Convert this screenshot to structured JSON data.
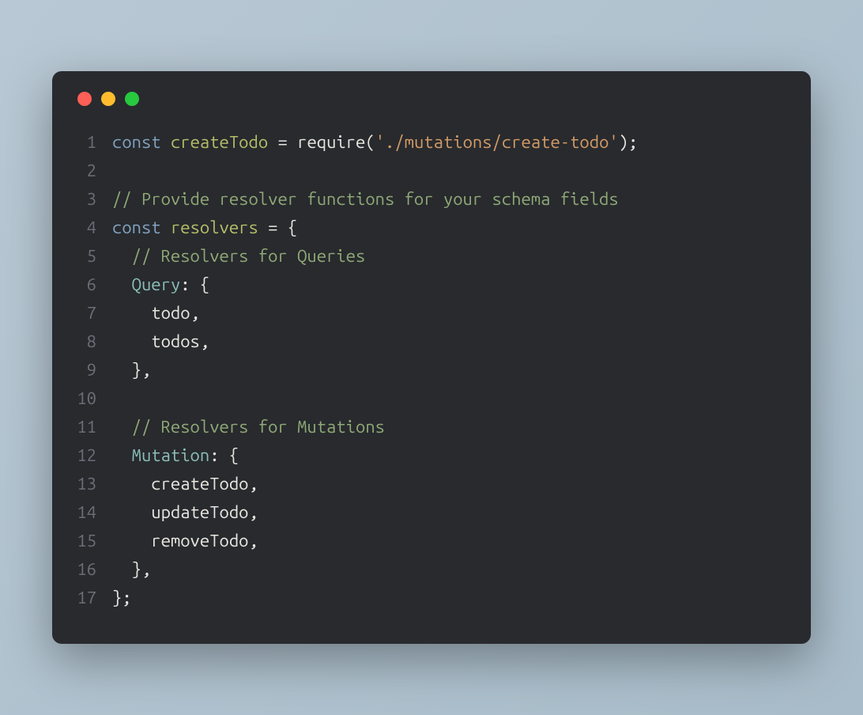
{
  "window": {
    "traffic_lights": {
      "red": "#ff5f56",
      "yellow": "#ffbd2e",
      "green": "#27c93f"
    }
  },
  "code": {
    "lines": [
      {
        "num": "1",
        "tokens": [
          {
            "t": "keyword",
            "v": "const"
          },
          {
            "t": "default",
            "v": " "
          },
          {
            "t": "declvar",
            "v": "createTodo"
          },
          {
            "t": "default",
            "v": " "
          },
          {
            "t": "punct",
            "v": "="
          },
          {
            "t": "default",
            "v": " "
          },
          {
            "t": "func",
            "v": "require"
          },
          {
            "t": "punct",
            "v": "("
          },
          {
            "t": "string",
            "v": "'./mutations/create-todo'"
          },
          {
            "t": "punct",
            "v": ");"
          }
        ]
      },
      {
        "num": "2",
        "tokens": []
      },
      {
        "num": "3",
        "tokens": [
          {
            "t": "comment",
            "v": "// Provide resolver functions for your schema fields"
          }
        ]
      },
      {
        "num": "4",
        "tokens": [
          {
            "t": "keyword",
            "v": "const"
          },
          {
            "t": "default",
            "v": " "
          },
          {
            "t": "declvar",
            "v": "resolvers"
          },
          {
            "t": "default",
            "v": " "
          },
          {
            "t": "punct",
            "v": "="
          },
          {
            "t": "default",
            "v": " "
          },
          {
            "t": "punct",
            "v": "{"
          }
        ]
      },
      {
        "num": "5",
        "tokens": [
          {
            "t": "default",
            "v": "  "
          },
          {
            "t": "comment",
            "v": "// Resolvers for Queries"
          }
        ]
      },
      {
        "num": "6",
        "tokens": [
          {
            "t": "default",
            "v": "  "
          },
          {
            "t": "prop",
            "v": "Query"
          },
          {
            "t": "punct",
            "v": ": {"
          }
        ]
      },
      {
        "num": "7",
        "tokens": [
          {
            "t": "default",
            "v": "    todo"
          },
          {
            "t": "punct",
            "v": ","
          }
        ]
      },
      {
        "num": "8",
        "tokens": [
          {
            "t": "default",
            "v": "    todos"
          },
          {
            "t": "punct",
            "v": ","
          }
        ]
      },
      {
        "num": "9",
        "tokens": [
          {
            "t": "default",
            "v": "  "
          },
          {
            "t": "punct",
            "v": "},"
          }
        ]
      },
      {
        "num": "10",
        "tokens": []
      },
      {
        "num": "11",
        "tokens": [
          {
            "t": "default",
            "v": "  "
          },
          {
            "t": "comment",
            "v": "// Resolvers for Mutations"
          }
        ]
      },
      {
        "num": "12",
        "tokens": [
          {
            "t": "default",
            "v": "  "
          },
          {
            "t": "prop",
            "v": "Mutation"
          },
          {
            "t": "punct",
            "v": ": {"
          }
        ]
      },
      {
        "num": "13",
        "tokens": [
          {
            "t": "default",
            "v": "    createTodo"
          },
          {
            "t": "punct",
            "v": ","
          }
        ]
      },
      {
        "num": "14",
        "tokens": [
          {
            "t": "default",
            "v": "    updateTodo"
          },
          {
            "t": "punct",
            "v": ","
          }
        ]
      },
      {
        "num": "15",
        "tokens": [
          {
            "t": "default",
            "v": "    removeTodo"
          },
          {
            "t": "punct",
            "v": ","
          }
        ]
      },
      {
        "num": "16",
        "tokens": [
          {
            "t": "default",
            "v": "  "
          },
          {
            "t": "punct",
            "v": "},"
          }
        ]
      },
      {
        "num": "17",
        "tokens": [
          {
            "t": "punct",
            "v": "};"
          }
        ]
      }
    ]
  }
}
